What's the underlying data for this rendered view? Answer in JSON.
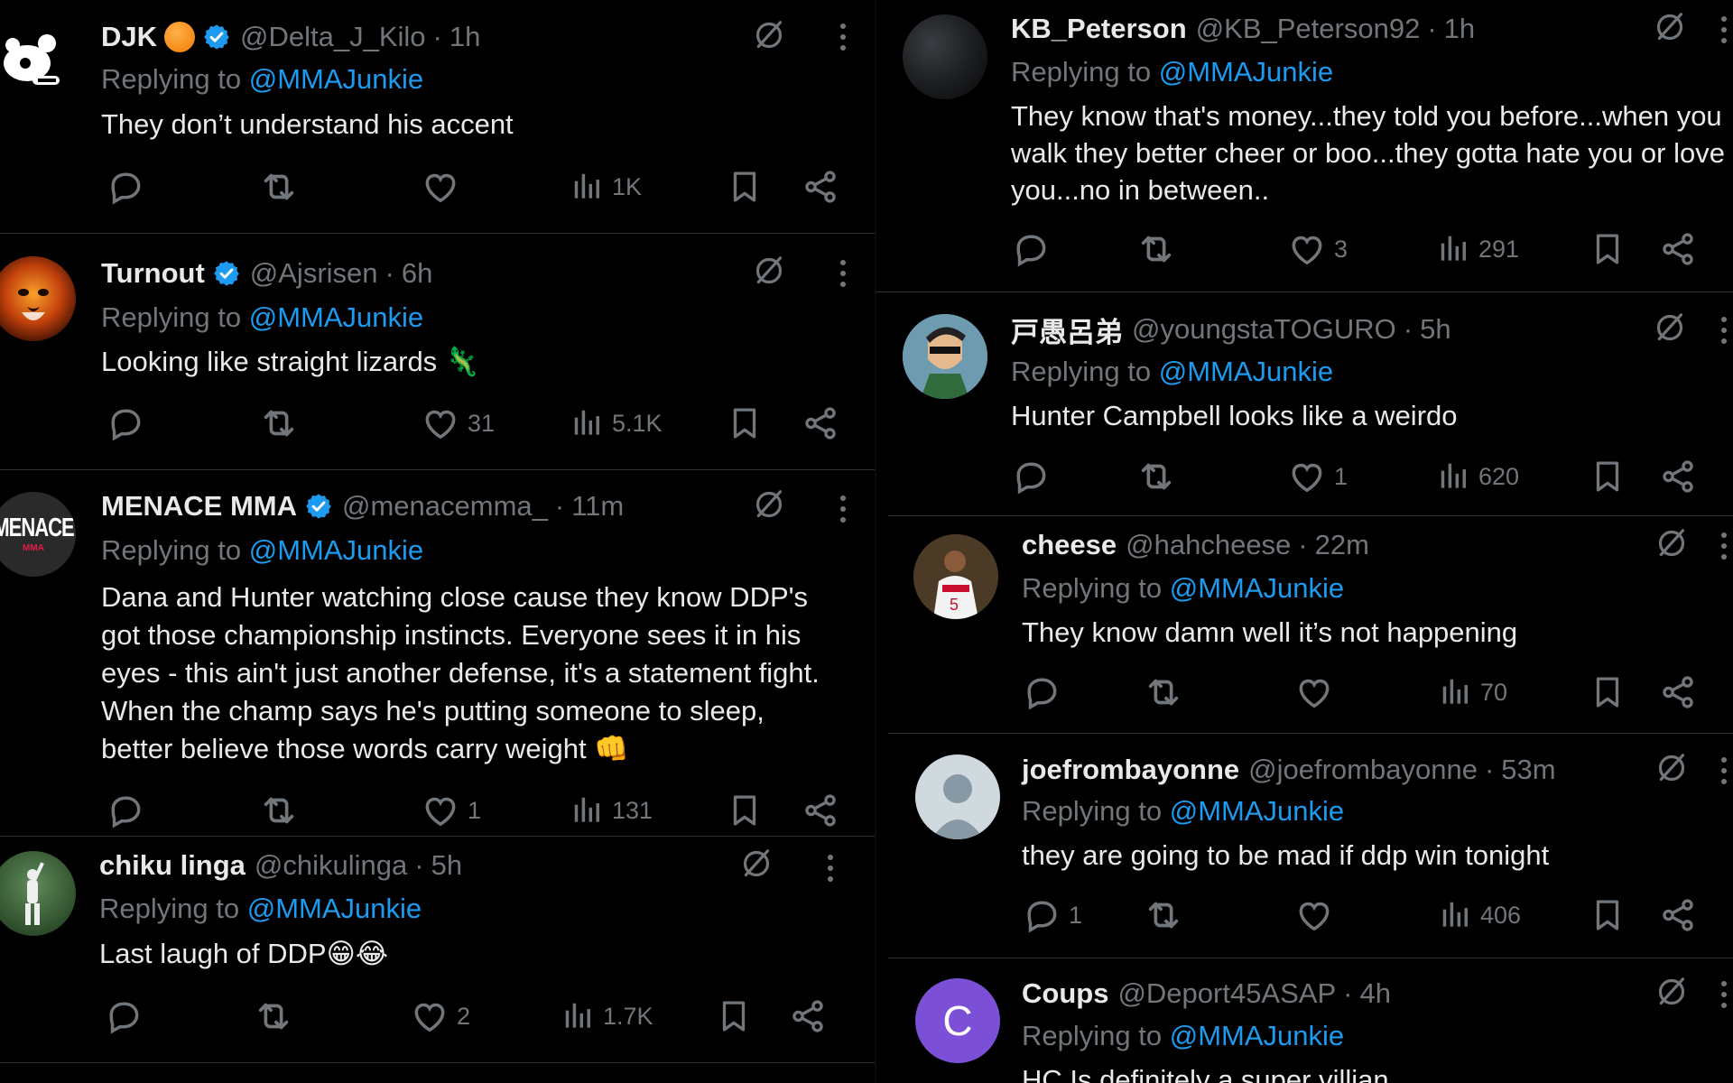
{
  "left_column": {
    "tweets": [
      {
        "name": "DJK",
        "handle": "@Delta_J_Kilo",
        "time": "1h",
        "replying_prefix": "Replying to",
        "replying_to": "@MMAJunkie",
        "text": "They don’t understand his accent",
        "replies": "",
        "reposts": "",
        "likes": "",
        "views": "1K",
        "avatar_icon": "doodle-avatar-icon",
        "verified": true,
        "has_orange_badge": true
      },
      {
        "name": "Turnout",
        "handle": "@Ajsrisen",
        "time": "6h",
        "replying_prefix": "Replying to",
        "replying_to": "@MMAJunkie",
        "text": "Looking like straight lizards 🦎",
        "replies": "",
        "reposts": "",
        "likes": "31",
        "views": "5.1K",
        "avatar_icon": "lion-avatar-icon",
        "verified": true
      },
      {
        "name": "MENACE MMA",
        "handle": "@menacemma_",
        "time": "11m",
        "replying_prefix": "Replying to",
        "replying_to": "@MMAJunkie",
        "text_lines": [
          "Dana and Hunter watching close cause they know DDP's",
          "got those championship instincts. Everyone sees it in his",
          "eyes - this ain't just another defense, it's a statement fight.",
          "When the champ says he's putting someone to sleep,",
          "better believe those words carry weight 👊"
        ],
        "replies": "",
        "reposts": "",
        "likes": "1",
        "views": "131",
        "avatar_logo_text": "MENACE",
        "avatar_logo_sub": "MMA",
        "verified": true
      },
      {
        "name": "chiku linga",
        "handle": "@chikulinga",
        "time": "5h",
        "replying_prefix": "Replying to",
        "replying_to": "@MMAJunkie",
        "text": "Last laugh of DDP😁😂",
        "replies": "",
        "reposts": "",
        "likes": "2",
        "views": "1.7K",
        "avatar_icon": "cricket-player-avatar-icon"
      }
    ]
  },
  "right_column": {
    "tweets": [
      {
        "name": "KB_Peterson",
        "handle": "@KB_Peterson92",
        "time": "1h",
        "replying_prefix": "Replying to",
        "replying_to": "@MMAJunkie",
        "text_lines": [
          "They know that's money...they told you before...when you",
          "walk they better cheer or boo...they gotta hate you or love",
          "you...no in between.."
        ],
        "replies": "",
        "reposts": "",
        "likes": "3",
        "views": "291",
        "avatar_icon": "dark-sphere-avatar-icon"
      },
      {
        "name": "戸愚呂弟",
        "handle": "@youngstaTOGURO",
        "time": "5h",
        "replying_prefix": "Replying to",
        "replying_to": "@MMAJunkie",
        "text": "Hunter Campbell looks like a weirdo",
        "replies": "",
        "reposts": "",
        "likes": "1",
        "views": "620",
        "avatar_icon": "anime-character-avatar-icon"
      },
      {
        "name": "cheese",
        "handle": "@hahcheese",
        "time": "22m",
        "replying_prefix": "Replying to",
        "replying_to": "@MMAJunkie",
        "text": "They know damn well it’s not happening",
        "replies": "",
        "reposts": "",
        "likes": "",
        "views": "70",
        "avatar_icon": "football-player-avatar-icon"
      },
      {
        "name": "joefrombayonne",
        "handle": "@joefrombayonne",
        "time": "53m",
        "replying_prefix": "Replying to",
        "replying_to": "@MMAJunkie",
        "text": "they are going to be mad if ddp win tonight",
        "replies": "1",
        "reposts": "",
        "likes": "",
        "views": "406",
        "avatar_icon": "default-person-avatar-icon"
      },
      {
        "name": "Coups",
        "handle": "@Deport45ASAP",
        "time": "4h",
        "replying_prefix": "Replying to",
        "replying_to": "@MMAJunkie",
        "text": "HC Is definitely a super villian",
        "replies": "",
        "reposts": "",
        "likes": "",
        "views": "",
        "avatar_letter": "C"
      }
    ]
  },
  "colors": {
    "background": "#000000",
    "text": "#e7e9ea",
    "muted": "#71767b",
    "link": "#1d9bf0",
    "verified": "#1d9bf0",
    "divider": "#2f3336",
    "letter_avatar": "#7b4fd6"
  }
}
